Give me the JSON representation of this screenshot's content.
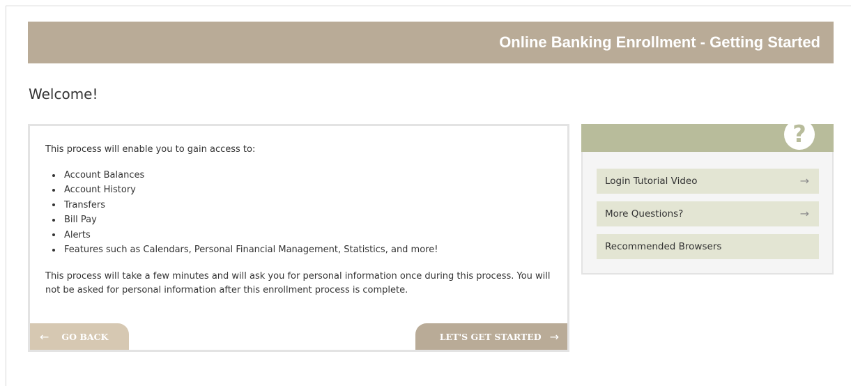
{
  "header": {
    "title": "Online Banking Enrollment - Getting Started"
  },
  "welcome": "Welcome!",
  "main": {
    "intro": "This process will enable you to gain access to:",
    "features": [
      "Account Balances",
      "Account History",
      "Transfers",
      "Bill Pay",
      "Alerts",
      "Features such as Calendars, Personal Financial Management, Statistics, and more!"
    ],
    "outro": "This process will take a few minutes and will ask you for personal information once during this process. You will not be asked for personal information after this enrollment process is complete.",
    "go_back_label": "GO BACK",
    "go_back_arrow": "←",
    "get_started_label": "LET'S GET STARTED",
    "get_started_arrow": "→"
  },
  "help": {
    "icon_glyph": "?",
    "icon_name": "question-mark-icon",
    "links": [
      {
        "label": "Login Tutorial Video",
        "arrow": "→"
      },
      {
        "label": "More Questions?",
        "arrow": "→"
      },
      {
        "label": "Recommended Browsers",
        "arrow": ""
      }
    ]
  },
  "colors": {
    "header": "#b9ab97",
    "go_back": "#d6c8b2",
    "help_header": "#b8bc9b",
    "help_link_bg": "#e3e5d3"
  }
}
